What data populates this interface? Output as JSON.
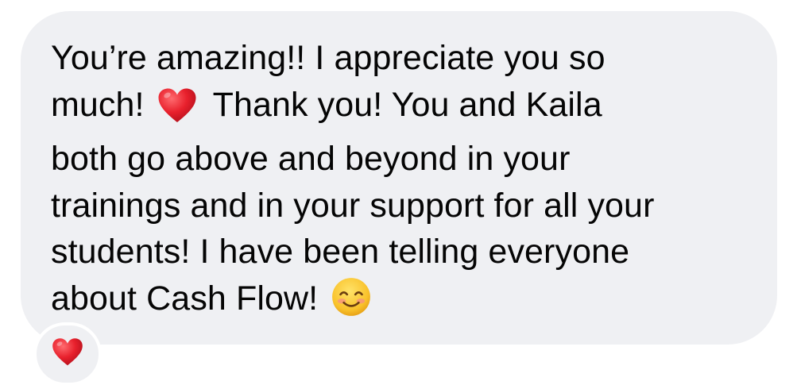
{
  "message": {
    "line1": "You’re amazing!! I appreciate you so",
    "line2a": "much!",
    "line2b": "Thank you! You and Kaila",
    "line3": "both go above and beyond in your",
    "line4": "trainings and in your support for all your",
    "line5": "students! I have been telling everyone",
    "line6": "about Cash Flow!",
    "inline_emoji_1": "heart-icon",
    "inline_emoji_2": "smiling-face-icon"
  },
  "reaction": {
    "emoji": "heart-icon"
  },
  "colors": {
    "bubble_background": "#eff0f3",
    "text": "#050505",
    "heart": "#e8202c",
    "smile": "#f9c22b"
  }
}
